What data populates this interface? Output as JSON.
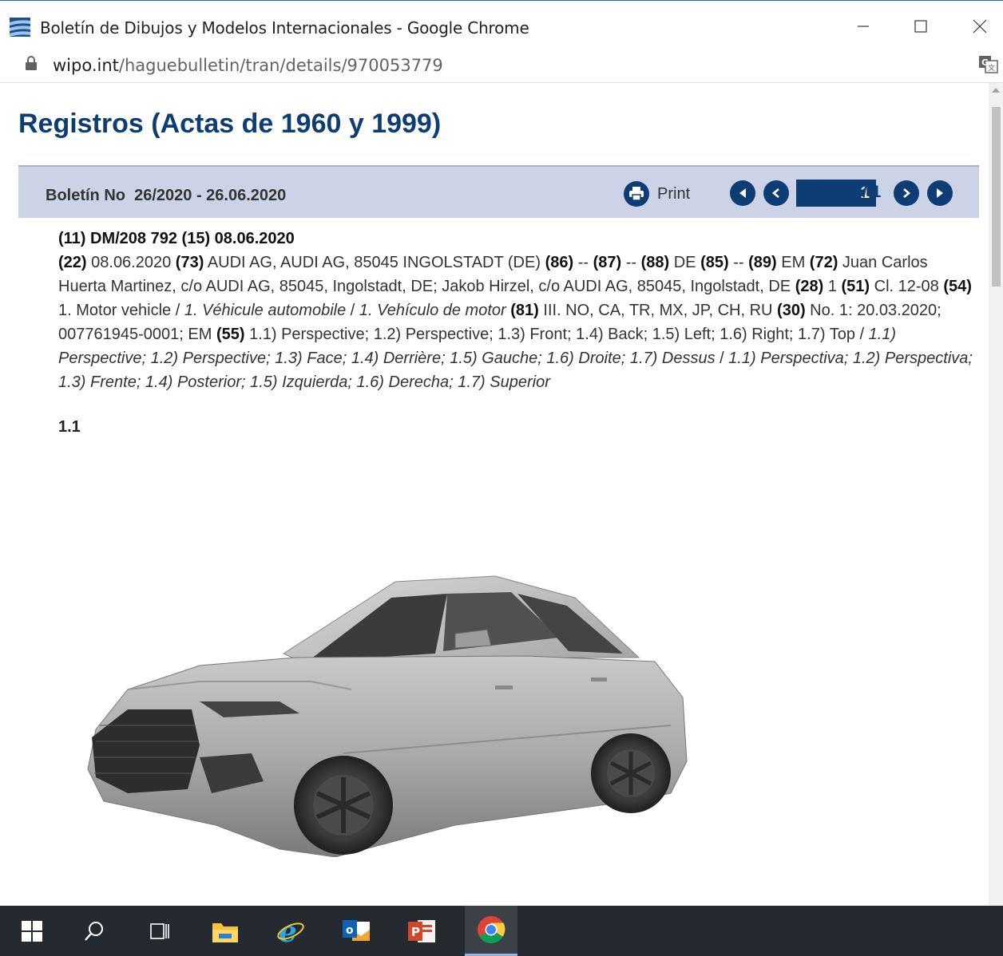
{
  "window": {
    "title": "Boletín de Dibujos y Modelos Internacionales - Google Chrome"
  },
  "address_bar": {
    "host": "wipo.int",
    "path": "/haguebulletin/tran/details/970053779"
  },
  "page": {
    "title": "Registros (Actas de 1960 y 1999)",
    "bulletin_label": "Boletín No  26/2020 - 26.06.2020",
    "print_label": "Print",
    "pagination": {
      "current": "1",
      "total": "/ 1"
    }
  },
  "record": {
    "header": "(11) DM/208 792 (15) 08.06.2020",
    "segments": [
      {
        "text": "(22)",
        "style": "bold"
      },
      {
        "text": " 08.06.2020 ",
        "style": "normal"
      },
      {
        "text": "(73)",
        "style": "bold"
      },
      {
        "text": " AUDI AG, AUDI AG, 85045 INGOLSTADT (DE) ",
        "style": "normal"
      },
      {
        "text": "(86)",
        "style": "bold"
      },
      {
        "text": " -- ",
        "style": "normal"
      },
      {
        "text": "(87)",
        "style": "bold"
      },
      {
        "text": " -- ",
        "style": "normal"
      },
      {
        "text": "(88)",
        "style": "bold"
      },
      {
        "text": " DE ",
        "style": "normal"
      },
      {
        "text": "(85)",
        "style": "bold"
      },
      {
        "text": " -- ",
        "style": "normal"
      },
      {
        "text": "(89)",
        "style": "bold"
      },
      {
        "text": " EM ",
        "style": "normal"
      },
      {
        "text": "(72)",
        "style": "bold"
      },
      {
        "text": " Juan Carlos Huerta Martinez, c/o AUDI AG, 85045, Ingolstadt, DE; Jakob Hirzel, c/o AUDI AG, 85045, Ingolstadt, DE ",
        "style": "normal"
      },
      {
        "text": "(28)",
        "style": "bold"
      },
      {
        "text": " 1 ",
        "style": "normal"
      },
      {
        "text": "(51)",
        "style": "bold"
      },
      {
        "text": " Cl. 12-08 ",
        "style": "normal"
      },
      {
        "text": "(54)",
        "style": "bold"
      },
      {
        "text": " 1. Motor vehicle / ",
        "style": "normal"
      },
      {
        "text": "1. Véhicule automobile",
        "style": "italic"
      },
      {
        "text": " / ",
        "style": "normal"
      },
      {
        "text": "1. Vehículo de motor",
        "style": "italic"
      },
      {
        "text": " ",
        "style": "normal"
      },
      {
        "text": "(81)",
        "style": "bold"
      },
      {
        "text": " III. NO, CA, TR, MX, JP, CH, RU ",
        "style": "normal"
      },
      {
        "text": "(30)",
        "style": "bold"
      },
      {
        "text": " No. 1: 20.03.2020; 007761945-0001; EM ",
        "style": "normal"
      },
      {
        "text": "(55)",
        "style": "bold"
      },
      {
        "text": " 1.1) Perspective; 1.2) Perspective; 1.3) Front; 1.4) Back; 1.5) Left; 1.6) Right; 1.7) Top / ",
        "style": "normal"
      },
      {
        "text": "1.1) Perspective; 1.2) Perspective; 1.3) Face; 1.4) Derrière; 1.5) Gauche; 1.6) Droite; 1.7) Dessus",
        "style": "italic"
      },
      {
        "text": " / ",
        "style": "normal"
      },
      {
        "text": "1.1) Perspectiva; 1.2) Perspectiva; 1.3) Frente; 1.4) Posterior; 1.5) Izquierda; 1.6) Derecha; 1.7) Superior",
        "style": "italic"
      }
    ]
  },
  "figure": {
    "label": "1.1",
    "image_icon": "car-perspective-drawing"
  },
  "taskbar": {
    "items": [
      "windows-start-icon",
      "search-icon",
      "task-view-icon",
      "file-explorer-icon",
      "internet-explorer-icon",
      "outlook-icon",
      "powerpoint-icon",
      "chrome-icon"
    ]
  },
  "colors": {
    "accent": "#0d3d73",
    "bulletin_bar": "#ccd3e6",
    "taskbar": "#252a30"
  }
}
